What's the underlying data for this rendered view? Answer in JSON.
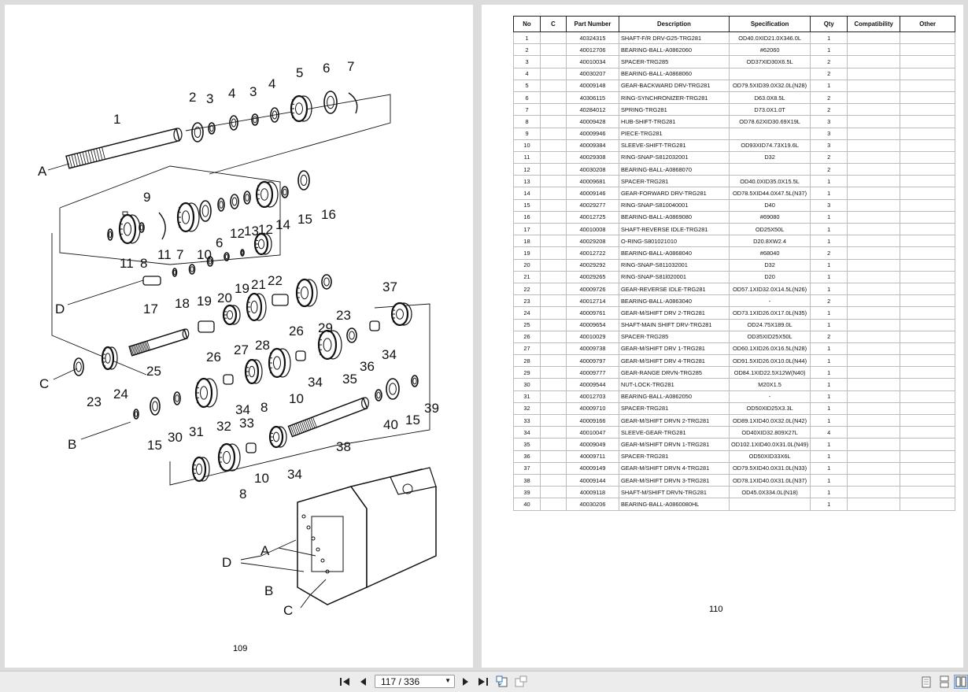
{
  "viewer": {
    "page_indicator": "117 / 336",
    "controls": [
      "first-page",
      "previous-page",
      "next-page",
      "last-page",
      "rotate-left",
      "rotate-right",
      "single-page",
      "continuous",
      "two-page"
    ]
  },
  "left_page": {
    "page_number": "109",
    "diagram": {
      "callouts": [
        "1",
        "2",
        "3",
        "4",
        "3",
        "4",
        "5",
        "6",
        "7",
        "9",
        "11",
        "8",
        "11",
        "7",
        "10",
        "6",
        "12",
        "13",
        "12",
        "14",
        "15",
        "16",
        "17",
        "18",
        "19",
        "20",
        "19",
        "21",
        "22",
        "37",
        "23",
        "24",
        "25",
        "26",
        "27",
        "28",
        "26",
        "29",
        "23",
        "34",
        "36",
        "35",
        "34",
        "10",
        "8",
        "34",
        "33",
        "32",
        "31",
        "30",
        "15",
        "40",
        "15",
        "39",
        "38",
        "34",
        "10",
        "8"
      ],
      "letters": [
        "A",
        "D",
        "C",
        "B",
        "A",
        "D",
        "B",
        "C"
      ]
    }
  },
  "right_page": {
    "page_number": "110",
    "table": {
      "headers": [
        "No",
        "C",
        "Part Number",
        "Description",
        "Specification",
        "Qty",
        "Compatibility",
        "Other"
      ],
      "rows": [
        [
          "1",
          "",
          "40324315",
          "SHAFT-F/R DRV-G25-TRG281",
          "OD40.0XID21.0X346.0L",
          "1",
          "",
          ""
        ],
        [
          "2",
          "",
          "40012706",
          "BEARING-BALL-A0862060",
          "#62060",
          "1",
          "",
          ""
        ],
        [
          "3",
          "",
          "40010034",
          "SPACER-TRG285",
          "OD37XID30X6.5L",
          "2",
          "",
          ""
        ],
        [
          "4",
          "",
          "40030207",
          "BEARING-BALL-A0868060",
          "",
          "2",
          "",
          ""
        ],
        [
          "5",
          "",
          "40009148",
          "GEAR-BACKWARD DRV-TRG281",
          "OD79.5XID39.0X32.0L(N28)",
          "1",
          "",
          ""
        ],
        [
          "6",
          "",
          "40306115",
          "RING-SYNCHRONIZER-TRG281",
          "D63.0X8.5L",
          "2",
          "",
          ""
        ],
        [
          "7",
          "",
          "40284012",
          "SPRING-TRG281",
          "D73.0X1.0T",
          "2",
          "",
          ""
        ],
        [
          "8",
          "",
          "40009428",
          "HUB-SHIFT-TRG281",
          "OD78.62XID30.69X19L",
          "3",
          "",
          ""
        ],
        [
          "9",
          "",
          "40009946",
          "PIECE-TRG281",
          "",
          "3",
          "",
          ""
        ],
        [
          "10",
          "",
          "40009384",
          "SLEEVE-SHIFT-TRG281",
          "OD93XID74.73X19.6L",
          "3",
          "",
          ""
        ],
        [
          "11",
          "",
          "40029308",
          "RING-SNAP-S812032001",
          "D32",
          "2",
          "",
          ""
        ],
        [
          "12",
          "",
          "40030208",
          "BEARING-BALL-A0868070",
          "",
          "2",
          "",
          ""
        ],
        [
          "13",
          "",
          "40009681",
          "SPACER-TRG281",
          "OD40.0XID35.0X15.5L",
          "1",
          "",
          ""
        ],
        [
          "14",
          "",
          "40009146",
          "GEAR-FORWARD DRV-TRG281",
          "OD78.5XID44.0X47.5L(N37)",
          "1",
          "",
          ""
        ],
        [
          "15",
          "",
          "40029277",
          "RING-SNAP-S810040001",
          "D40",
          "3",
          "",
          ""
        ],
        [
          "16",
          "",
          "40012725",
          "BEARING-BALL-A0869080",
          "#69080",
          "1",
          "",
          ""
        ],
        [
          "17",
          "",
          "40010008",
          "SHAFT-REVERSE IDLE-TRG281",
          "OD25X50L",
          "1",
          "",
          ""
        ],
        [
          "18",
          "",
          "40029208",
          "O-RING-S801021010",
          "D20.8XW2.4",
          "1",
          "",
          ""
        ],
        [
          "19",
          "",
          "40012722",
          "BEARING-BALL-A0868040",
          "#68040",
          "2",
          "",
          ""
        ],
        [
          "20",
          "",
          "40029292",
          "RING-SNAP-S811032001",
          "D32",
          "1",
          "",
          ""
        ],
        [
          "21",
          "",
          "40029265",
          "RING-SNAP-S81l020001",
          "D20",
          "1",
          "",
          ""
        ],
        [
          "22",
          "",
          "40009726",
          "GEAR-REVERSE IDLE-TRG281",
          "OD57.1XID32.0X14.5L(N26)",
          "1",
          "",
          ""
        ],
        [
          "23",
          "",
          "40012714",
          "BEARING-BALL-A0863040",
          "-",
          "2",
          "",
          ""
        ],
        [
          "24",
          "",
          "40009761",
          "GEAR-M/SHIFT DRV 2-TRG281",
          "OD73.1XID26.0X17.0L(N35)",
          "1",
          "",
          ""
        ],
        [
          "25",
          "",
          "40009654",
          "SHAFT-MAIN SHIFT DRV-TRG281",
          "OD24.75X189.0L",
          "1",
          "",
          ""
        ],
        [
          "26",
          "",
          "40010029",
          "SPACER-TRG285",
          "OD35XID25X50L",
          "2",
          "",
          ""
        ],
        [
          "27",
          "",
          "40009738",
          "GEAR-M/SHIFT DRV 1-TRG281",
          "OD60.1XID26.0X16.5L(N28)",
          "1",
          "",
          ""
        ],
        [
          "28",
          "",
          "40009797",
          "GEAR-M/SHIFT DRV 4-TRG281",
          "OD91.5XID26.0X10.0L(N44)",
          "1",
          "",
          ""
        ],
        [
          "29",
          "",
          "40009777",
          "GEAR-RANGE DRVN-TRG285",
          "OD84.1XID22.5X12W(N40)",
          "1",
          "",
          ""
        ],
        [
          "30",
          "",
          "40009544",
          "NUT-LOCK-TRG281",
          "M20X1.5",
          "1",
          "",
          ""
        ],
        [
          "31",
          "",
          "40012703",
          "BEARING-BALL-A0862050",
          "-",
          "1",
          "",
          ""
        ],
        [
          "32",
          "",
          "40009710",
          "SPACER-TRG281",
          "OD50XID25X3.3L",
          "1",
          "",
          ""
        ],
        [
          "33",
          "",
          "40009166",
          "GEAR-M/SHIFT DRVN 2-TRG281",
          "OD89.1XID40.0X32.0L(N42)",
          "1",
          "",
          ""
        ],
        [
          "34",
          "",
          "40010047",
          "SLEEVE-GEAR-TRG281",
          "OD40XID32.809X27L",
          "4",
          "",
          ""
        ],
        [
          "35",
          "",
          "40009049",
          "GEAR-M/SHIFT DRVN 1-TRG281",
          "OD102.1XID40.0X31.0L(N49)",
          "1",
          "",
          ""
        ],
        [
          "36",
          "",
          "40009711",
          "SPACER-TRG281",
          "OD50XID33X6L",
          "1",
          "",
          ""
        ],
        [
          "37",
          "",
          "40009149",
          "GEAR-M/SHIFT DRVN 4-TRG281",
          "OD79.5XID40.0X31.0L(N33)",
          "1",
          "",
          ""
        ],
        [
          "38",
          "",
          "40009144",
          "GEAR-M/SHIFT DRVN 3-TRG281",
          "OD78.1XID40.0X31.0L(N37)",
          "1",
          "",
          ""
        ],
        [
          "39",
          "",
          "40009118",
          "SHAFT-M/SHIFT DRVN-TRG281",
          "OD45.0X334.0L(N18)",
          "1",
          "",
          ""
        ],
        [
          "40",
          "",
          "40030206",
          "BEARING-BALL-A0860080HL",
          "",
          "1",
          "",
          ""
        ]
      ]
    }
  }
}
